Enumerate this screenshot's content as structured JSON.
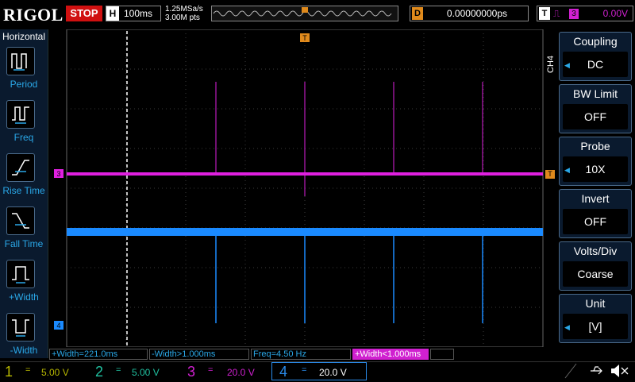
{
  "brand": "RIGOL",
  "run_state": "STOP",
  "horizontal": {
    "label": "H",
    "timebase": "100ms",
    "sample_rate": "1.25MSa/s",
    "memory_depth": "3.00M pts"
  },
  "delay": {
    "label": "D",
    "value": "0.00000000ps"
  },
  "trigger": {
    "label": "T",
    "source": "3",
    "level": "0.00V"
  },
  "left_menu": {
    "heading": "Horizontal",
    "items": [
      {
        "label": "Period"
      },
      {
        "label": "Freq"
      },
      {
        "label": "Rise Time"
      },
      {
        "label": "Fall Time"
      },
      {
        "label": "+Width"
      },
      {
        "label": "-Width"
      }
    ]
  },
  "right_menu": {
    "channel": "CH4",
    "items": [
      {
        "title": "Coupling",
        "value": "DC"
      },
      {
        "title": "BW Limit",
        "value": "OFF"
      },
      {
        "title": "Probe",
        "value": "10X"
      },
      {
        "title": "Invert",
        "value": "OFF"
      },
      {
        "title": "Volts/Div",
        "value": "Coarse"
      },
      {
        "title": "Unit",
        "value": "[V]"
      }
    ]
  },
  "markers": {
    "ch3": "3",
    "ch4": "4",
    "trigger_top": "T",
    "trigger_right": "T"
  },
  "measurements": [
    {
      "text": "+Width=221.0ms",
      "color": "#2aa8e8"
    },
    {
      "text": "-Width>1.000ms",
      "color": "#2aa8e8"
    },
    {
      "text": "Freq=4.50 Hz",
      "color": "#2aa8e8"
    },
    {
      "text": "+Width<1.000ms",
      "color": "#d020d0"
    }
  ],
  "channels": [
    {
      "num": "1",
      "scale": "5.00 V",
      "color": "#b8b800"
    },
    {
      "num": "2",
      "scale": "5.00 V",
      "color": "#20c0a0"
    },
    {
      "num": "3",
      "scale": "20.0 V",
      "color": "#d020d0"
    },
    {
      "num": "4",
      "scale": "20.0 V",
      "color": "#2a8ae8"
    }
  ],
  "colors": {
    "ch3": "#e020e0",
    "ch4": "#1a8aff",
    "accent": "#2aa8e8",
    "trigger": "#e08a1c",
    "stop": "#d01010"
  }
}
